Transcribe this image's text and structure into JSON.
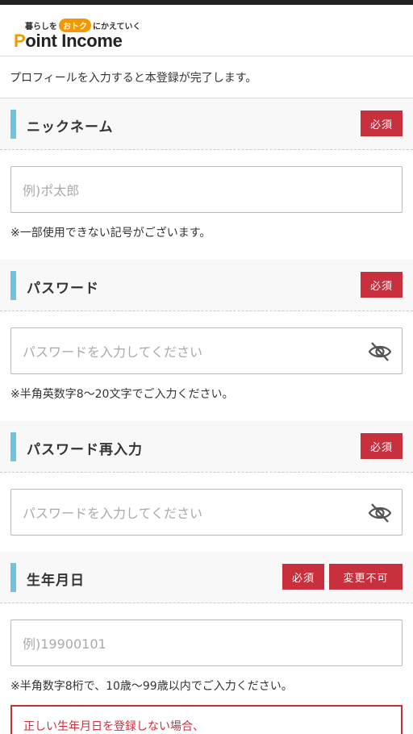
{
  "header": {
    "tagline_pre": "暮らしを",
    "tagline_bubble": "おトク",
    "tagline_post": "にかえていく",
    "logo_p": "P",
    "logo_rest": "oint Income"
  },
  "intro": "プロフィールを入力すると本登録が完了します。",
  "sections": {
    "nickname": {
      "title": "ニックネーム",
      "required": "必須",
      "placeholder": "例)ポ太郎",
      "note": "※一部使用できない記号がございます。"
    },
    "password": {
      "title": "パスワード",
      "required": "必須",
      "placeholder": "パスワードを入力してください",
      "note": "※半角英数字8〜20文字でご入力ください。",
      "icon": "eye-slash-icon"
    },
    "password_confirm": {
      "title": "パスワード再入力",
      "required": "必須",
      "placeholder": "パスワードを入力してください",
      "icon": "eye-slash-icon"
    },
    "birthday": {
      "title": "生年月日",
      "required": "必須",
      "unchangeable": "変更不可",
      "placeholder": "例)19900101",
      "note": "※半角数字8桁で、10歳〜99歳以内でご入力ください。"
    }
  },
  "warning": "正しい生年月日を登録しない場合、",
  "colors": {
    "accent_bar": "#6fc3dc",
    "badge_red": "#c8303d",
    "logo_orange": "#f39800"
  }
}
